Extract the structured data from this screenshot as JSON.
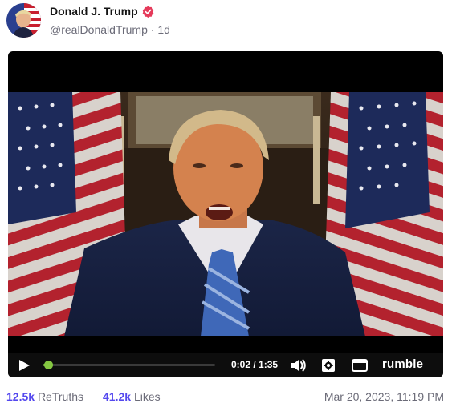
{
  "post": {
    "author_name": "Donald J. Trump",
    "handle": "@realDonaldTrump",
    "separator": "·",
    "age": "1d",
    "timestamp": "Mar 20, 2023, 11:19 PM"
  },
  "video": {
    "time_display": "0:02 / 1:35",
    "progress": 0.015,
    "brand": "rumble"
  },
  "stats": {
    "retruths_count": "12.5k",
    "retruths_label": "ReTruths",
    "likes_count": "41.2k",
    "likes_label": "Likes"
  },
  "colors": {
    "accent": "#5448ee",
    "verified": "#e53a5a",
    "progress": "#85c742"
  },
  "icons": [
    "verified-badge-icon",
    "play-icon",
    "volume-icon",
    "settings-icon",
    "fullscreen-icon"
  ]
}
